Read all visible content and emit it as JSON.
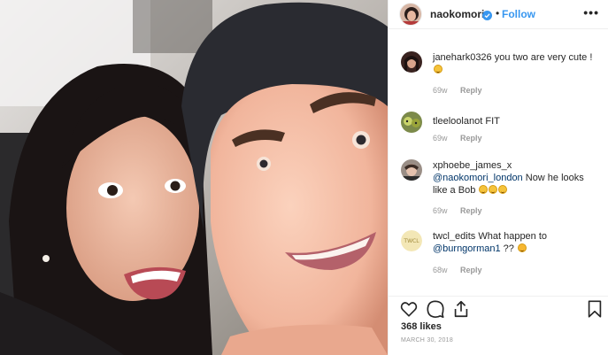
{
  "header": {
    "username": "naokomori",
    "separator": "•",
    "follow_label": "Follow",
    "more_label": "•••",
    "verified_icon": "verified-badge-icon"
  },
  "comments": [
    {
      "username": "janehark0326",
      "text": "you two are very cute !",
      "emoji_count": 1,
      "time": "69w",
      "reply_label": "Reply"
    },
    {
      "username": "tleeloolanot",
      "text": "FIT",
      "emoji_count": 0,
      "time": "69w",
      "reply_label": "Reply"
    },
    {
      "username": "xphoebe_james_x",
      "mention": "@naokomori_london",
      "text": "Now he looks like a Bob",
      "emoji_count": 3,
      "time": "69w",
      "reply_label": "Reply"
    },
    {
      "username": "twcl_edits",
      "text": "What happen to",
      "mention": "@burngorman1",
      "text_after": "??",
      "emoji_count": 1,
      "time": "68w",
      "reply_label": "Reply"
    }
  ],
  "actions": {
    "like_icon": "heart-icon",
    "comment_icon": "comment-icon",
    "share_icon": "share-icon",
    "save_icon": "bookmark-icon"
  },
  "likes": "368 likes",
  "date": "MARCH 30, 2018",
  "colors": {
    "link": "#3897f0",
    "mention": "#003569",
    "muted": "#999999",
    "text": "#262626"
  }
}
